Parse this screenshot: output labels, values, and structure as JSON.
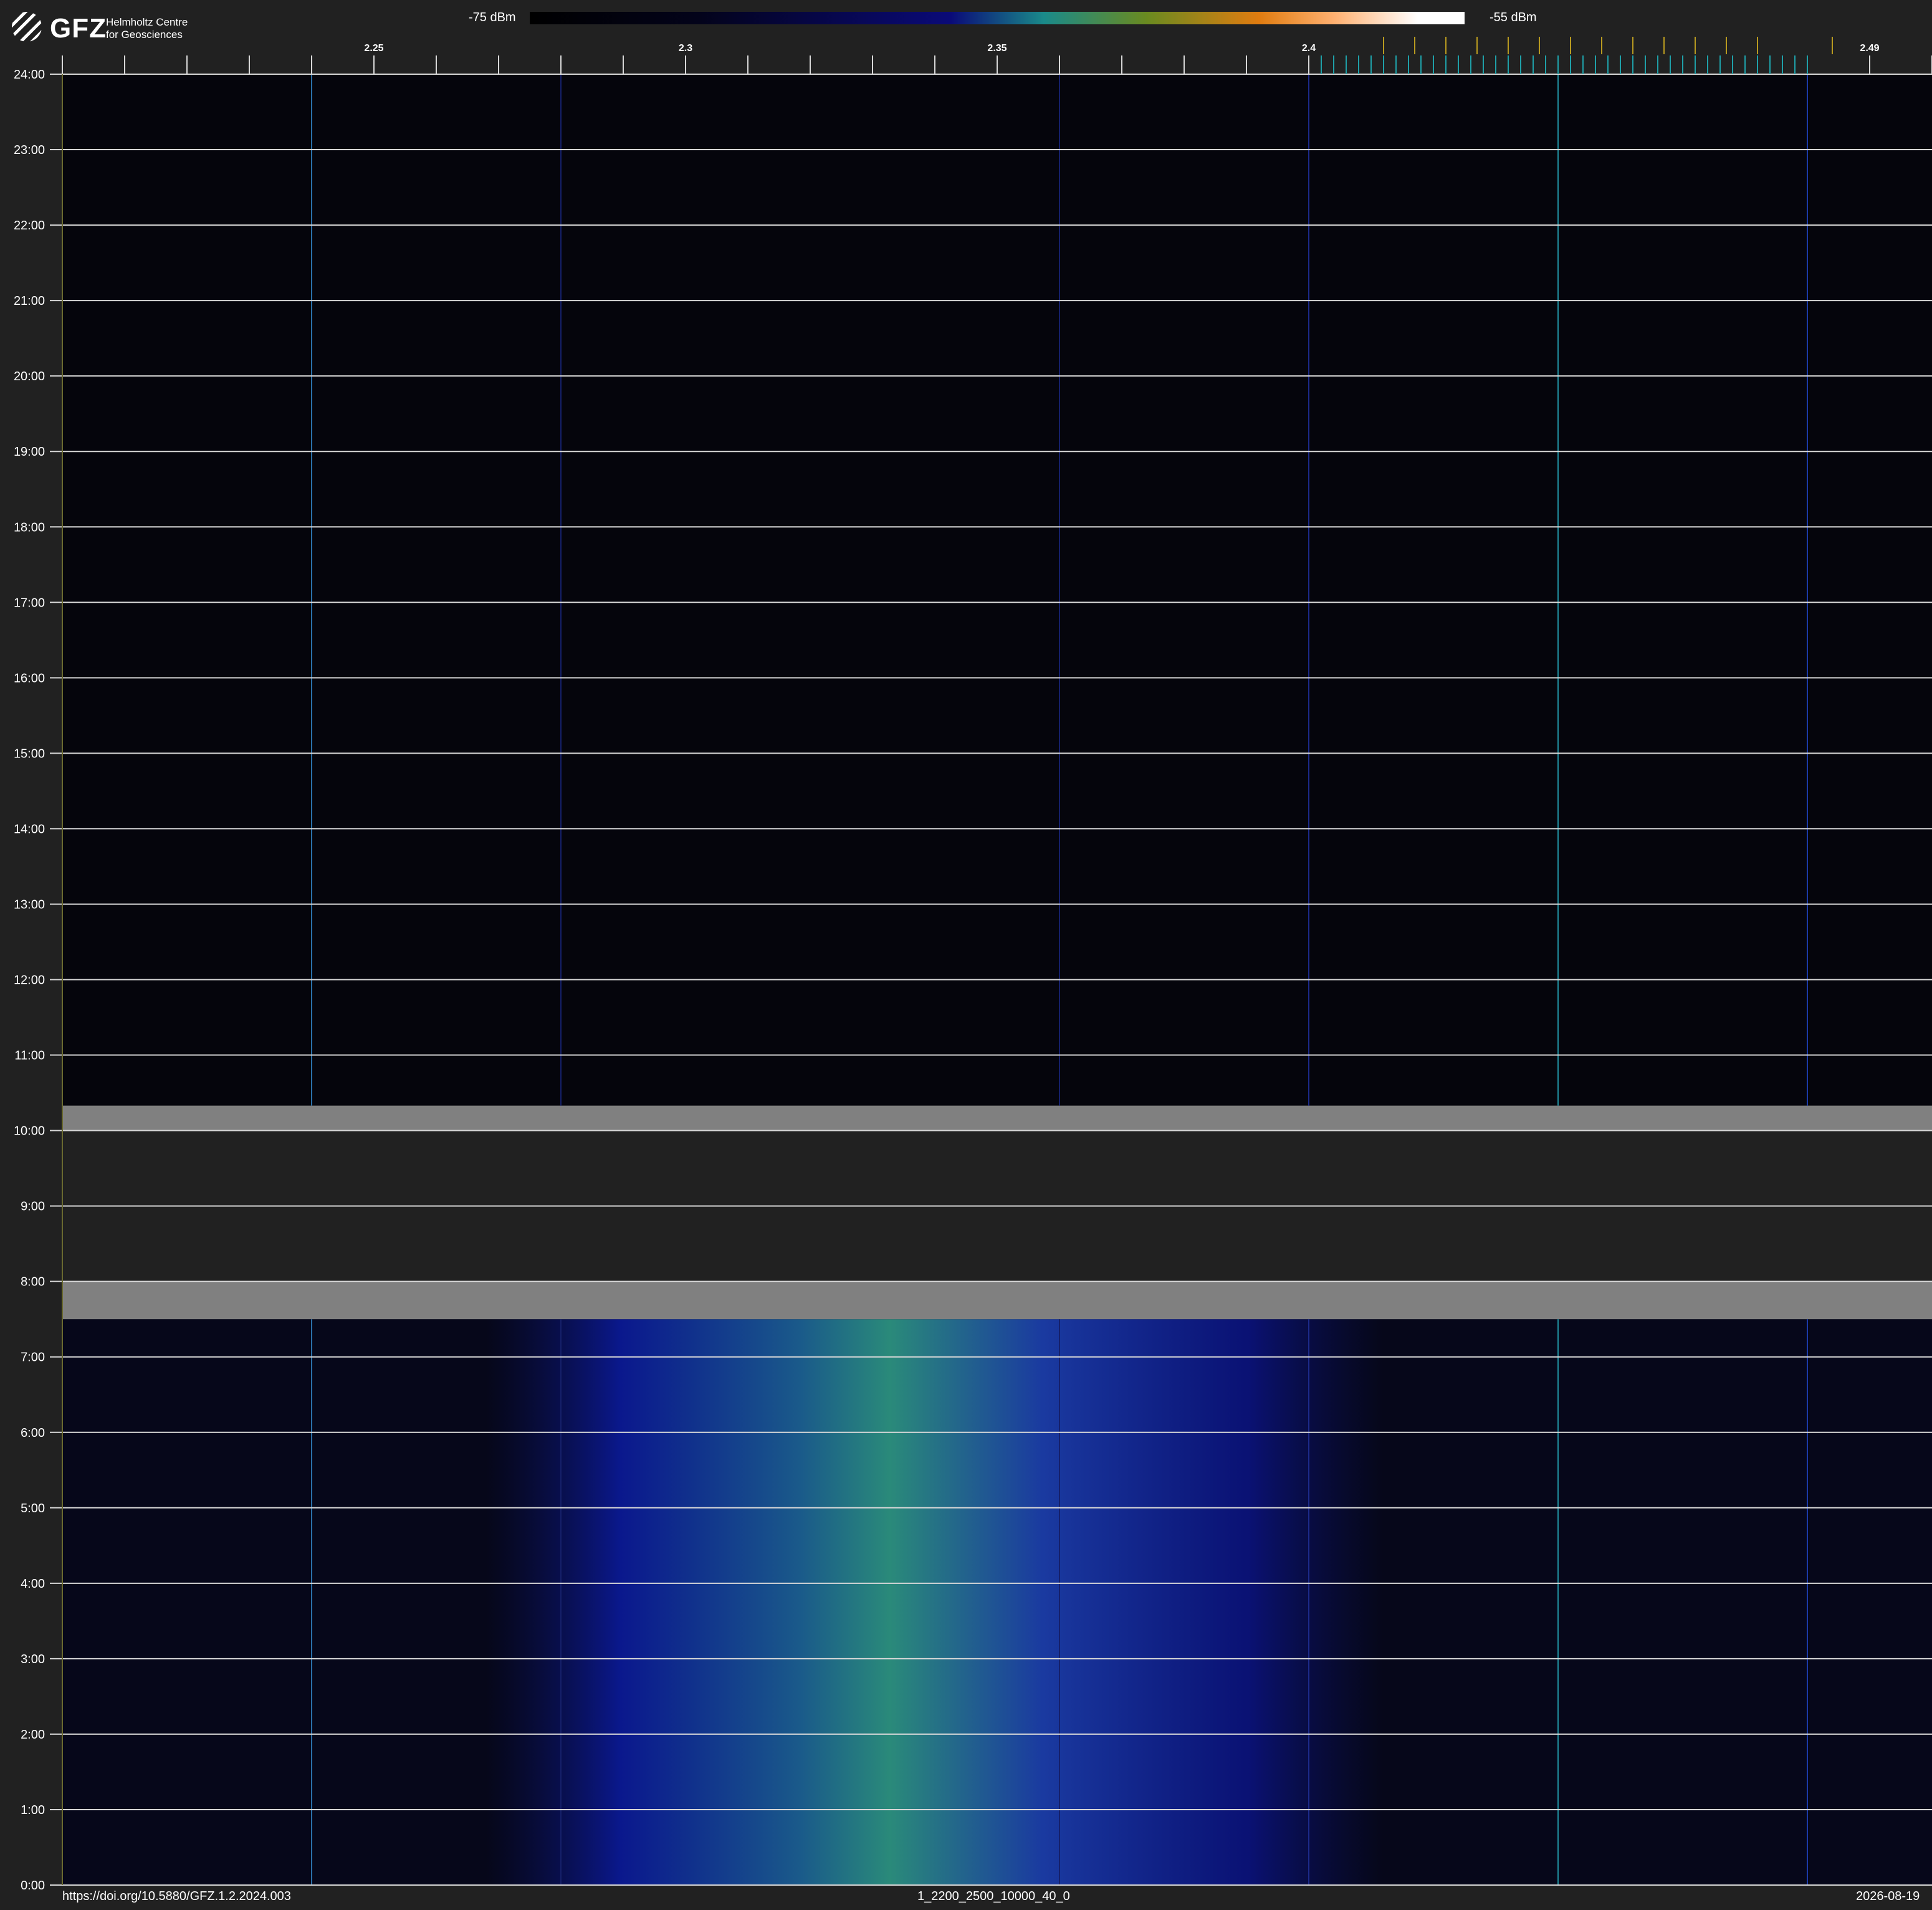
{
  "logo": {
    "name": "GFZ",
    "subtitle_line1": "Helmholtz Centre",
    "subtitle_line2": "for Geosciences"
  },
  "colorbar": {
    "min_label": "-75 dBm",
    "max_label": "-55 dBm",
    "colors": [
      "#000000",
      "#0a0a78",
      "#1a8a8a",
      "#e07c10",
      "#ffffff"
    ]
  },
  "footer": {
    "doi": "https://doi.org/10.5880/GFZ.1.2.2024.003",
    "dataset": "1_2200_2500_10000_40_0",
    "date": "2026-08-19"
  },
  "chart_data": {
    "type": "heatmap",
    "x_range": [
      2.2,
      2.5
    ],
    "x_ticks": [
      "2.25",
      "2.3",
      "2.35",
      "2.4",
      "2.49"
    ],
    "x_tick_values": [
      2.25,
      2.3,
      2.35,
      2.4,
      2.49
    ],
    "y_range_hours": [
      0,
      24
    ],
    "y_ticks": [
      "0:00",
      "1:00",
      "2:00",
      "3:00",
      "4:00",
      "5:00",
      "6:00",
      "7:00",
      "8:00",
      "9:00",
      "10:00",
      "11:00",
      "12:00",
      "13:00",
      "14:00",
      "15:00",
      "16:00",
      "17:00",
      "18:00",
      "19:00",
      "20:00",
      "21:00",
      "22:00",
      "23:00",
      "24:00"
    ],
    "value_range_dBm": [
      -75,
      -55
    ],
    "no_data_hours": [
      8.0,
      10.0
    ],
    "gray_bands_hours": [
      [
        7.5,
        8.0
      ],
      [
        10.0,
        10.33
      ]
    ],
    "broadband_emission": {
      "hours": [
        0,
        7.5
      ],
      "x_center": 2.34,
      "x_halfwidth": 0.045,
      "peak_dBm": -66
    },
    "persistent_lines": [
      {
        "x": 2.24,
        "color": "#2a6fa8"
      },
      {
        "x": 2.28,
        "color": "#15206a"
      },
      {
        "x": 2.36,
        "color": "#15206a"
      },
      {
        "x": 2.4,
        "color": "#1b2a8a"
      },
      {
        "x": 2.44,
        "color": "#1f8a9a"
      },
      {
        "x": 2.48,
        "color": "#1b3aa8"
      }
    ],
    "marker_ticks_teal_x": [
      2.402,
      2.404,
      2.406,
      2.408,
      2.41,
      2.412,
      2.414,
      2.416,
      2.418,
      2.42,
      2.422,
      2.424,
      2.426,
      2.428,
      2.43,
      2.432,
      2.434,
      2.436,
      2.438,
      2.44,
      2.442,
      2.444,
      2.446,
      2.448,
      2.45,
      2.452,
      2.454,
      2.456,
      2.458,
      2.46,
      2.462,
      2.464,
      2.466,
      2.468,
      2.47,
      2.472,
      2.474,
      2.476,
      2.478,
      2.48
    ],
    "marker_ticks_gold_x": [
      2.412,
      2.417,
      2.422,
      2.427,
      2.432,
      2.437,
      2.442,
      2.447,
      2.452,
      2.457,
      2.462,
      2.467,
      2.472,
      2.484
    ]
  }
}
